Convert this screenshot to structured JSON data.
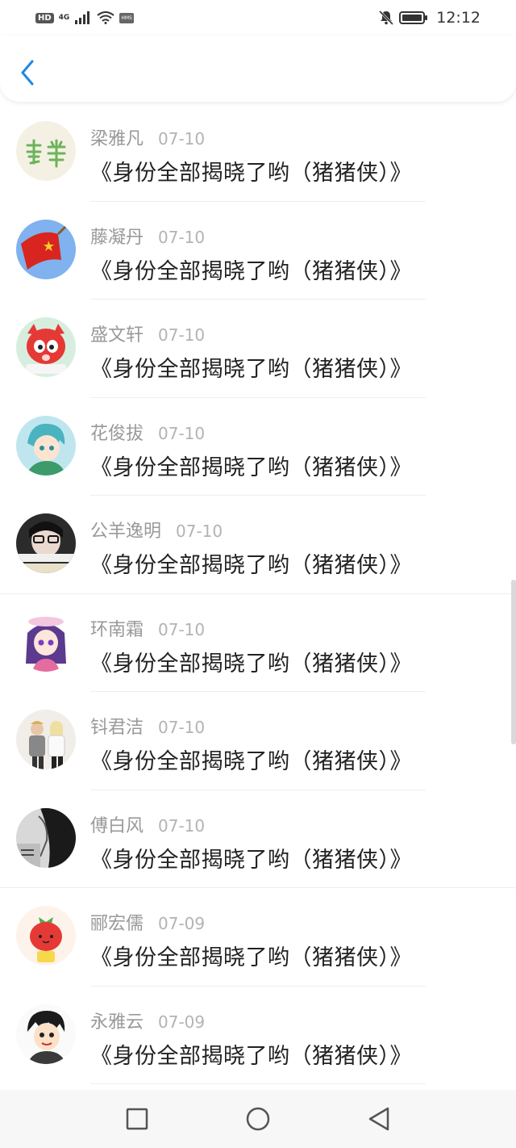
{
  "status_bar": {
    "hd_badge": "HD",
    "network": "4G",
    "hms_badge": "HMS",
    "time": "12:12"
  },
  "header": {
    "back_icon": "chevron-left-icon"
  },
  "list": {
    "items": [
      {
        "name": "梁雅凡",
        "date": "07-10",
        "title": "《身份全部揭晓了哟（猪猪侠）》",
        "avatar": "bg-plant-avatar"
      },
      {
        "name": "藤凝丹",
        "date": "07-10",
        "title": "《身份全部揭晓了哟（猪猪侠）》",
        "avatar": "flag-avatar"
      },
      {
        "name": "盛文轩",
        "date": "07-10",
        "title": "《身份全部揭晓了哟（猪猪侠）》",
        "avatar": "red-fox-avatar"
      },
      {
        "name": "花俊拔",
        "date": "07-10",
        "title": "《身份全部揭晓了哟（猪猪侠）》",
        "avatar": "anime-boy-avatar"
      },
      {
        "name": "公羊逸明",
        "date": "07-10",
        "title": "《身份全部揭晓了哟（猪猪侠）》",
        "avatar": "photo-girl-avatar"
      },
      {
        "name": "环南霜",
        "date": "07-10",
        "title": "《身份全部揭晓了哟（猪猪侠）》",
        "avatar": "anime-girl-avatar"
      },
      {
        "name": "钭君洁",
        "date": "07-10",
        "title": "《身份全部揭晓了哟（猪猪侠）》",
        "avatar": "couple-photo-avatar"
      },
      {
        "name": "傅白风",
        "date": "07-10",
        "title": "《身份全部揭晓了哟（猪猪侠）》",
        "avatar": "dark-photo-avatar"
      },
      {
        "name": "郦宏儒",
        "date": "07-09",
        "title": "《身份全部揭晓了哟（猪猪侠）》",
        "avatar": "strawberry-avatar"
      },
      {
        "name": "永雅云",
        "date": "07-09",
        "title": "《身份全部揭晓了哟（猪猪侠）》",
        "avatar": "cartoon-boy-avatar"
      }
    ]
  },
  "navbar": {
    "recent_icon": "square-icon",
    "home_icon": "circle-icon",
    "back_icon": "triangle-back-icon"
  },
  "colors": {
    "accent": "#1e88e5",
    "name_text": "#999999",
    "title_text": "#222222"
  }
}
